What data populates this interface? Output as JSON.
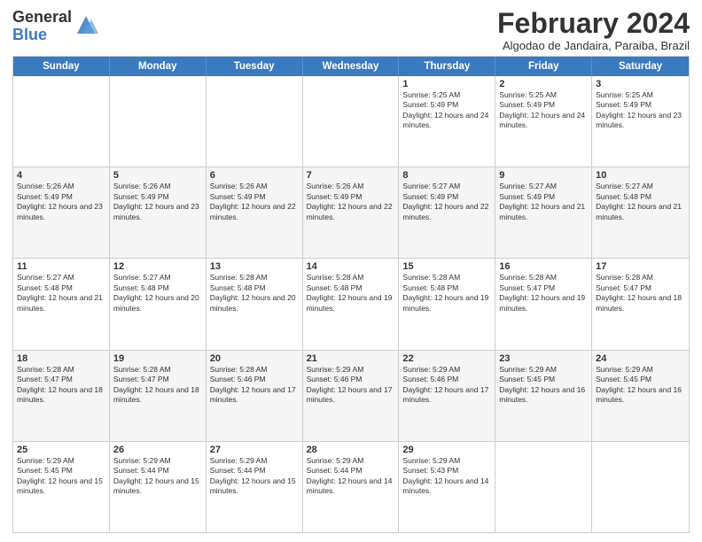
{
  "logo": {
    "general": "General",
    "blue": "Blue"
  },
  "title": {
    "month_year": "February 2024",
    "location": "Algodao de Jandaira, Paraiba, Brazil"
  },
  "days": [
    "Sunday",
    "Monday",
    "Tuesday",
    "Wednesday",
    "Thursday",
    "Friday",
    "Saturday"
  ],
  "weeks": [
    [
      {
        "date": "",
        "info": ""
      },
      {
        "date": "",
        "info": ""
      },
      {
        "date": "",
        "info": ""
      },
      {
        "date": "",
        "info": ""
      },
      {
        "date": "1",
        "info": "Sunrise: 5:25 AM\nSunset: 5:49 PM\nDaylight: 12 hours and 24 minutes."
      },
      {
        "date": "2",
        "info": "Sunrise: 5:25 AM\nSunset: 5:49 PM\nDaylight: 12 hours and 24 minutes."
      },
      {
        "date": "3",
        "info": "Sunrise: 5:25 AM\nSunset: 5:49 PM\nDaylight: 12 hours and 23 minutes."
      }
    ],
    [
      {
        "date": "4",
        "info": "Sunrise: 5:26 AM\nSunset: 5:49 PM\nDaylight: 12 hours and 23 minutes."
      },
      {
        "date": "5",
        "info": "Sunrise: 5:26 AM\nSunset: 5:49 PM\nDaylight: 12 hours and 23 minutes."
      },
      {
        "date": "6",
        "info": "Sunrise: 5:26 AM\nSunset: 5:49 PM\nDaylight: 12 hours and 22 minutes."
      },
      {
        "date": "7",
        "info": "Sunrise: 5:26 AM\nSunset: 5:49 PM\nDaylight: 12 hours and 22 minutes."
      },
      {
        "date": "8",
        "info": "Sunrise: 5:27 AM\nSunset: 5:49 PM\nDaylight: 12 hours and 22 minutes."
      },
      {
        "date": "9",
        "info": "Sunrise: 5:27 AM\nSunset: 5:49 PM\nDaylight: 12 hours and 21 minutes."
      },
      {
        "date": "10",
        "info": "Sunrise: 5:27 AM\nSunset: 5:48 PM\nDaylight: 12 hours and 21 minutes."
      }
    ],
    [
      {
        "date": "11",
        "info": "Sunrise: 5:27 AM\nSunset: 5:48 PM\nDaylight: 12 hours and 21 minutes."
      },
      {
        "date": "12",
        "info": "Sunrise: 5:27 AM\nSunset: 5:48 PM\nDaylight: 12 hours and 20 minutes."
      },
      {
        "date": "13",
        "info": "Sunrise: 5:28 AM\nSunset: 5:48 PM\nDaylight: 12 hours and 20 minutes."
      },
      {
        "date": "14",
        "info": "Sunrise: 5:28 AM\nSunset: 5:48 PM\nDaylight: 12 hours and 19 minutes."
      },
      {
        "date": "15",
        "info": "Sunrise: 5:28 AM\nSunset: 5:48 PM\nDaylight: 12 hours and 19 minutes."
      },
      {
        "date": "16",
        "info": "Sunrise: 5:28 AM\nSunset: 5:47 PM\nDaylight: 12 hours and 19 minutes."
      },
      {
        "date": "17",
        "info": "Sunrise: 5:28 AM\nSunset: 5:47 PM\nDaylight: 12 hours and 18 minutes."
      }
    ],
    [
      {
        "date": "18",
        "info": "Sunrise: 5:28 AM\nSunset: 5:47 PM\nDaylight: 12 hours and 18 minutes."
      },
      {
        "date": "19",
        "info": "Sunrise: 5:28 AM\nSunset: 5:47 PM\nDaylight: 12 hours and 18 minutes."
      },
      {
        "date": "20",
        "info": "Sunrise: 5:28 AM\nSunset: 5:46 PM\nDaylight: 12 hours and 17 minutes."
      },
      {
        "date": "21",
        "info": "Sunrise: 5:29 AM\nSunset: 5:46 PM\nDaylight: 12 hours and 17 minutes."
      },
      {
        "date": "22",
        "info": "Sunrise: 5:29 AM\nSunset: 5:46 PM\nDaylight: 12 hours and 17 minutes."
      },
      {
        "date": "23",
        "info": "Sunrise: 5:29 AM\nSunset: 5:45 PM\nDaylight: 12 hours and 16 minutes."
      },
      {
        "date": "24",
        "info": "Sunrise: 5:29 AM\nSunset: 5:45 PM\nDaylight: 12 hours and 16 minutes."
      }
    ],
    [
      {
        "date": "25",
        "info": "Sunrise: 5:29 AM\nSunset: 5:45 PM\nDaylight: 12 hours and 15 minutes."
      },
      {
        "date": "26",
        "info": "Sunrise: 5:29 AM\nSunset: 5:44 PM\nDaylight: 12 hours and 15 minutes."
      },
      {
        "date": "27",
        "info": "Sunrise: 5:29 AM\nSunset: 5:44 PM\nDaylight: 12 hours and 15 minutes."
      },
      {
        "date": "28",
        "info": "Sunrise: 5:29 AM\nSunset: 5:44 PM\nDaylight: 12 hours and 14 minutes."
      },
      {
        "date": "29",
        "info": "Sunrise: 5:29 AM\nSunset: 5:43 PM\nDaylight: 12 hours and 14 minutes."
      },
      {
        "date": "",
        "info": ""
      },
      {
        "date": "",
        "info": ""
      }
    ]
  ]
}
